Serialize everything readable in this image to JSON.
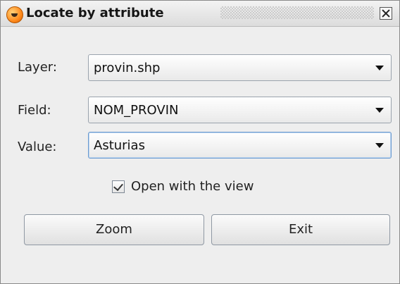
{
  "window": {
    "title": "Locate by attribute",
    "title_icon": "app-logo-icon",
    "close_icon": "close-icon"
  },
  "form": {
    "layer": {
      "label": "Layer:",
      "value": "provin.shp"
    },
    "field": {
      "label": "Field:",
      "value": "NOM_PROVIN"
    },
    "value": {
      "label": "Value:",
      "value": "Asturias"
    }
  },
  "checkbox": {
    "label": "Open with the view",
    "checked": true
  },
  "buttons": {
    "zoom": "Zoom",
    "exit": "Exit"
  }
}
